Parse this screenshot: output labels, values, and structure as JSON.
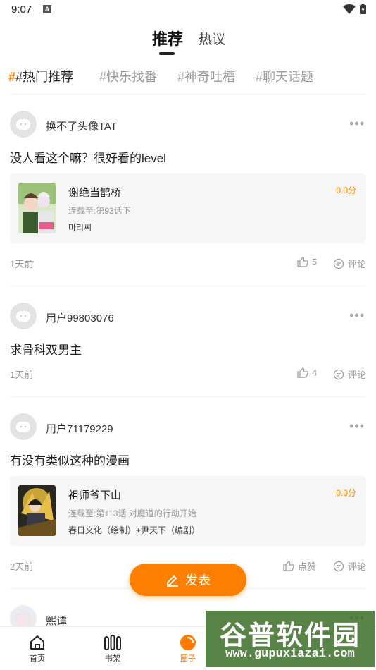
{
  "status_bar": {
    "time": "9:07",
    "notification_icon": "A"
  },
  "header": {
    "tabs": [
      {
        "label": "推荐",
        "active": true
      },
      {
        "label": "热议",
        "active": false
      }
    ]
  },
  "topics": [
    {
      "label": "#热门推荐",
      "active": true
    },
    {
      "label": "#快乐找番",
      "active": false
    },
    {
      "label": "#神奇吐槽",
      "active": false
    },
    {
      "label": "#聊天话题",
      "active": false
    }
  ],
  "active_topic_marker": "#",
  "posts": [
    {
      "username": "换不了头像TAT",
      "more": "•••",
      "text": "没人看这个嘛？很好看的level",
      "book": {
        "title": "谢绝当鹊桥",
        "status": "连载至:第93话下",
        "author": "마리씨",
        "score": "0.0分"
      },
      "time": "1天前",
      "likes": "5",
      "comment_label": "评论"
    },
    {
      "username": "用户99803076",
      "more": "•••",
      "text": "求骨科双男主",
      "time": "1天前",
      "likes": "4",
      "comment_label": "评论"
    },
    {
      "username": "用户71179229",
      "more": "•••",
      "text": "有没有类似这种的漫画",
      "book": {
        "title": "祖师爷下山",
        "status": "连载至:第113话 对魔道的行动开始",
        "author": "春日文化（绘制）+尹天下（编剧）",
        "score": "0.0分"
      },
      "time": "2天前",
      "likes": "点赞",
      "comment_label": "评论"
    },
    {
      "username": "熙谭",
      "more": "•••"
    }
  ],
  "publish_button": {
    "label": "发表"
  },
  "bottom_nav": [
    {
      "label": "首页",
      "icon": "home-icon",
      "active": false
    },
    {
      "label": "书架",
      "icon": "bookshelf-icon",
      "active": false
    },
    {
      "label": "圈子",
      "icon": "circle-icon",
      "active": true
    }
  ],
  "watermark": {
    "title": "谷普软件园",
    "url": "www.gupuxiazai.com"
  },
  "colors": {
    "accent": "#ff8000",
    "score": "#ff8a00",
    "muted": "#999999"
  }
}
